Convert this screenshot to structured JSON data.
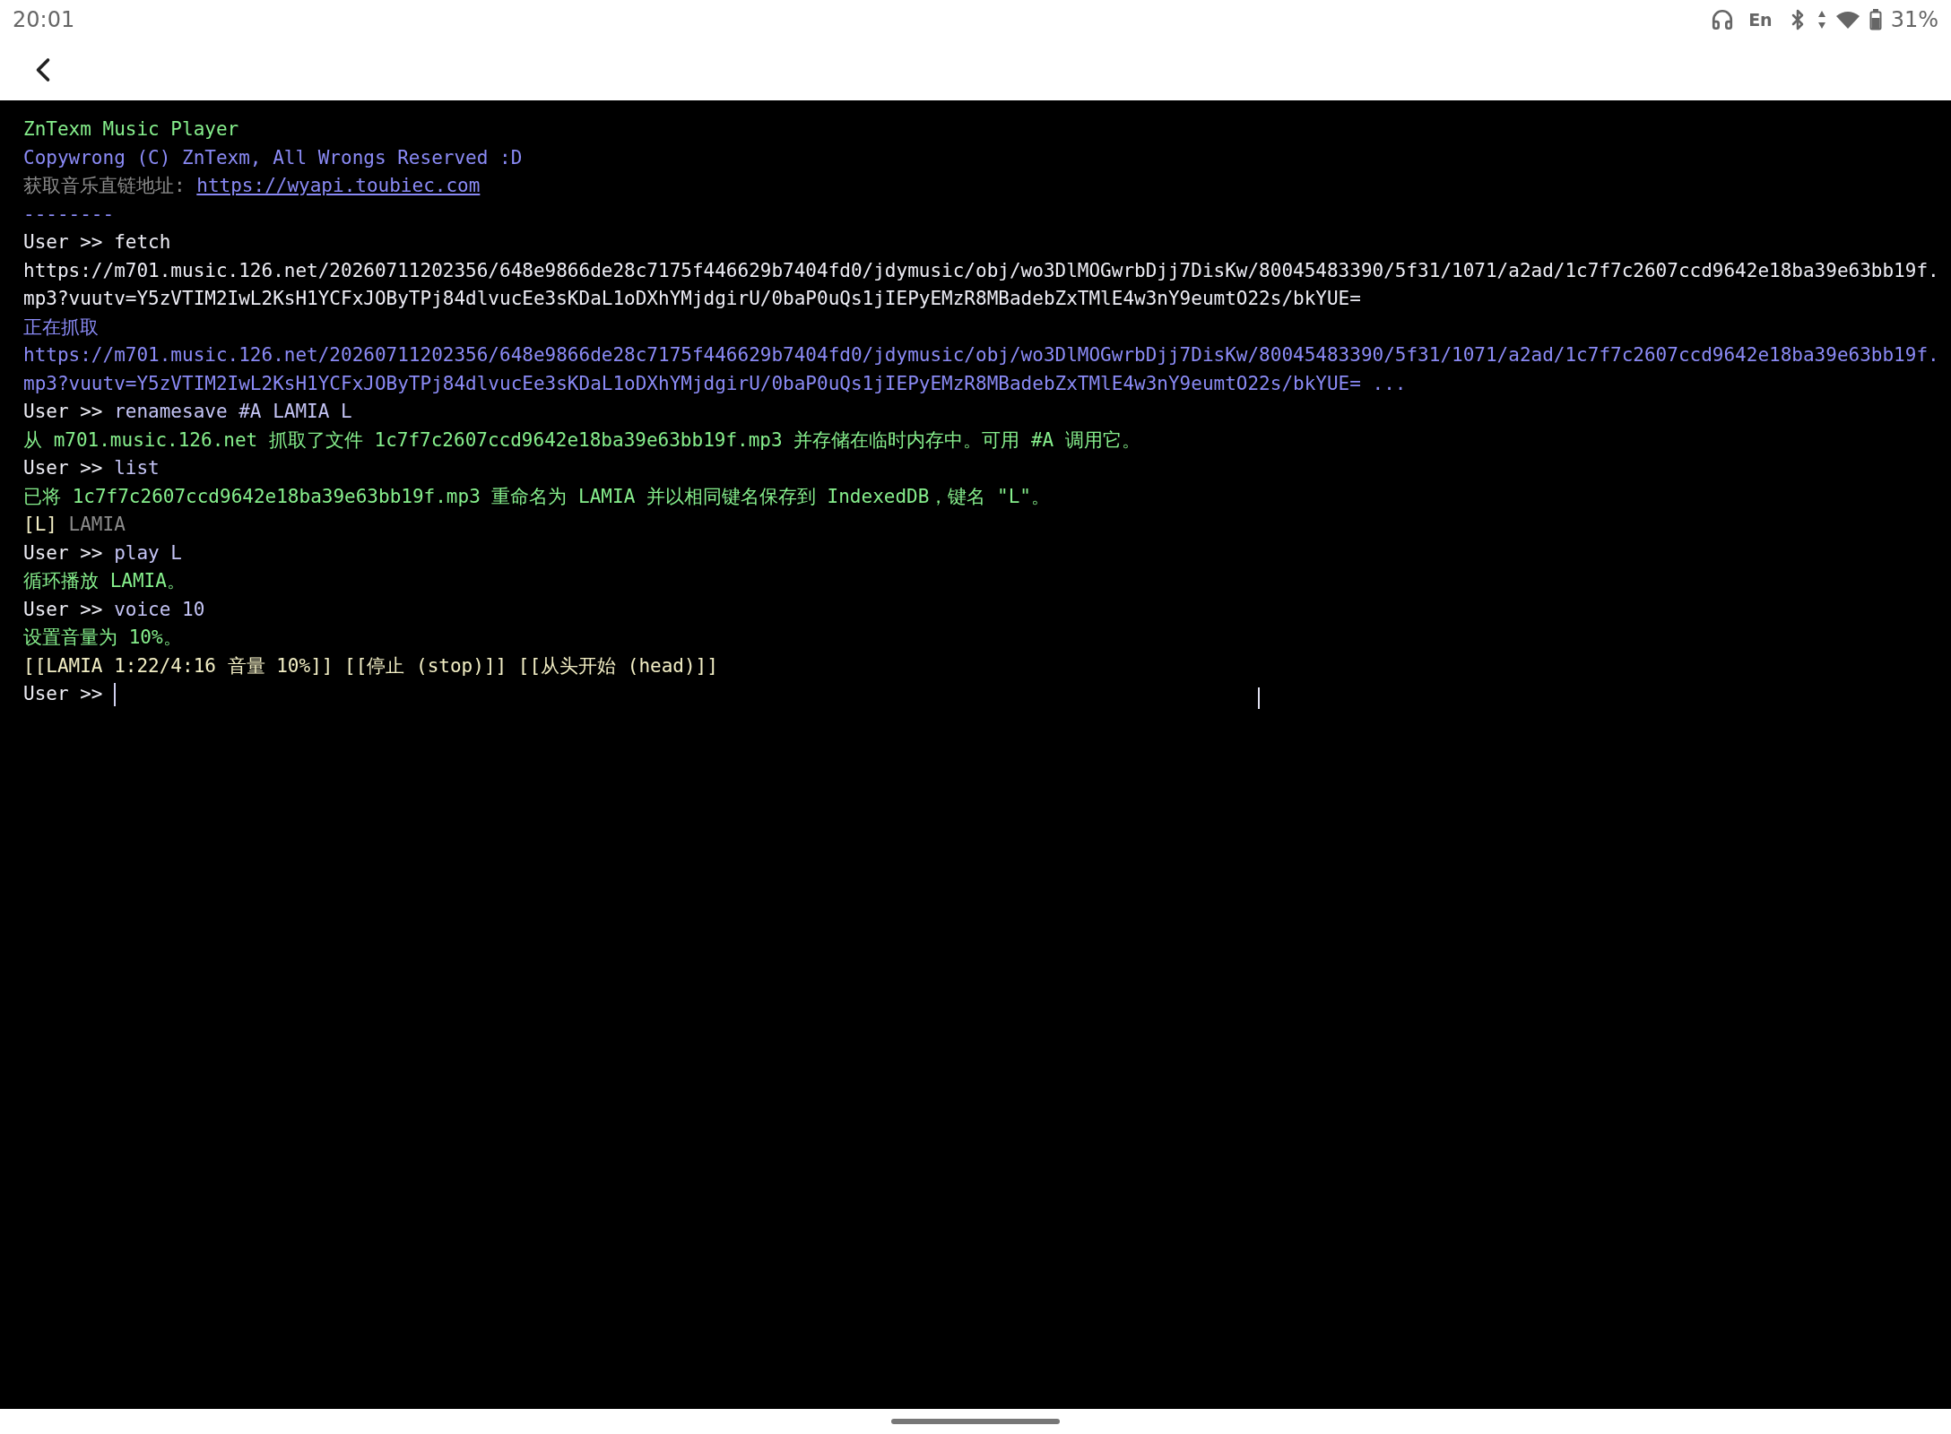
{
  "status_bar": {
    "time": "20:01",
    "input_method": "En",
    "battery": "31%"
  },
  "terminal": {
    "lines": [
      {
        "segments": [
          {
            "kind": "title",
            "text": "ZnTexm Music Player"
          }
        ]
      },
      {
        "segments": [
          {
            "kind": "info",
            "text": "Copywrong (C) ZnTexm, All Wrongs Reserved :D"
          }
        ]
      },
      {
        "segments": [
          {
            "kind": "note",
            "text": "获取音乐直链地址: "
          },
          {
            "kind": "link",
            "text": "https://wyapi.toubiec.com"
          }
        ]
      },
      {
        "segments": [
          {
            "kind": "info",
            "text": "--------"
          }
        ]
      },
      {
        "segments": [
          {
            "kind": "prompt",
            "text": "User >> "
          },
          {
            "kind": "echo",
            "text": "fetch"
          }
        ]
      },
      {
        "segments": [
          {
            "kind": "output",
            "text": "https://m701.music.126.net/20260711202356/648e9866de28c7175f446629b7404fd0/jdymusic/obj/wo3DlMOGwrbDjj7DisKw/80045483390/5f31/1071/a2ad/1c7f7c2607ccd9642e18ba39e63bb19f.mp3?vuutv=Y5zVTIM2IwL2KsH1YCFxJOByTPj84dlvucEe3sKDaL1oDXhYMjdgirU/0baP0uQs1jIEPyEMzR8MBadebZxTMlE4w3nY9eumtO22s/bkYUE="
          }
        ]
      },
      {
        "segments": [
          {
            "kind": "info",
            "text": "正在抓取"
          }
        ]
      },
      {
        "segments": [
          {
            "kind": "info",
            "text": "https://m701.music.126.net/20260711202356/648e9866de28c7175f446629b7404fd0/jdymusic/obj/wo3DlMOGwrbDjj7DisKw/80045483390/5f31/1071/a2ad/1c7f7c2607ccd9642e18ba39e63bb19f.mp3?vuutv=Y5zVTIM2IwL2KsH1YCFxJOByTPj84dlvucEe3sKDaL1oDXhYMjdgirU/0baP0uQs1jIEPyEMzR8MBadebZxTMlE4w3nY9eumtO22s/bkYUE= ..."
          }
        ]
      },
      {
        "segments": [
          {
            "kind": "prompt",
            "text": "User >> "
          },
          {
            "kind": "command",
            "text": "renamesave #A LAMIA L"
          }
        ]
      },
      {
        "segments": [
          {
            "kind": "success",
            "text": "从 m701.music.126.net 抓取了文件 1c7f7c2607ccd9642e18ba39e63bb19f.mp3 并存储在临时内存中。可用 #A 调用它。"
          }
        ]
      },
      {
        "segments": [
          {
            "kind": "prompt",
            "text": "User >> "
          },
          {
            "kind": "command",
            "text": "list"
          }
        ]
      },
      {
        "segments": [
          {
            "kind": "success",
            "text": "已将 1c7f7c2607ccd9642e18ba39e63bb19f.mp3 重命名为 LAMIA 并以相同键名保存到 IndexedDB，键名 \"L\"。"
          }
        ]
      },
      {
        "segments": [
          {
            "kind": "key",
            "text": "[L] "
          },
          {
            "kind": "dim",
            "text": "LAMIA"
          }
        ]
      },
      {
        "segments": [
          {
            "kind": "prompt",
            "text": "User >> "
          },
          {
            "kind": "command",
            "text": "play L"
          }
        ]
      },
      {
        "segments": [
          {
            "kind": "success",
            "text": "循环播放 LAMIA。"
          }
        ]
      },
      {
        "segments": [
          {
            "kind": "prompt",
            "text": "User >> "
          },
          {
            "kind": "command",
            "text": "voice 10"
          }
        ]
      },
      {
        "segments": [
          {
            "kind": "success",
            "text": "设置音量为 10%。"
          }
        ]
      },
      {
        "segments": [
          {
            "kind": "control",
            "text": "[[LAMIA 1:22/4:16 音量 10%]]"
          },
          {
            "kind": "control",
            "text": "[[停止 (stop)]]"
          },
          {
            "kind": "control",
            "text": "[[从头开始 (head)]]"
          }
        ]
      },
      {
        "segments": [
          {
            "kind": "prompt",
            "text": "User >> "
          },
          {
            "kind": "input"
          }
        ]
      }
    ]
  }
}
